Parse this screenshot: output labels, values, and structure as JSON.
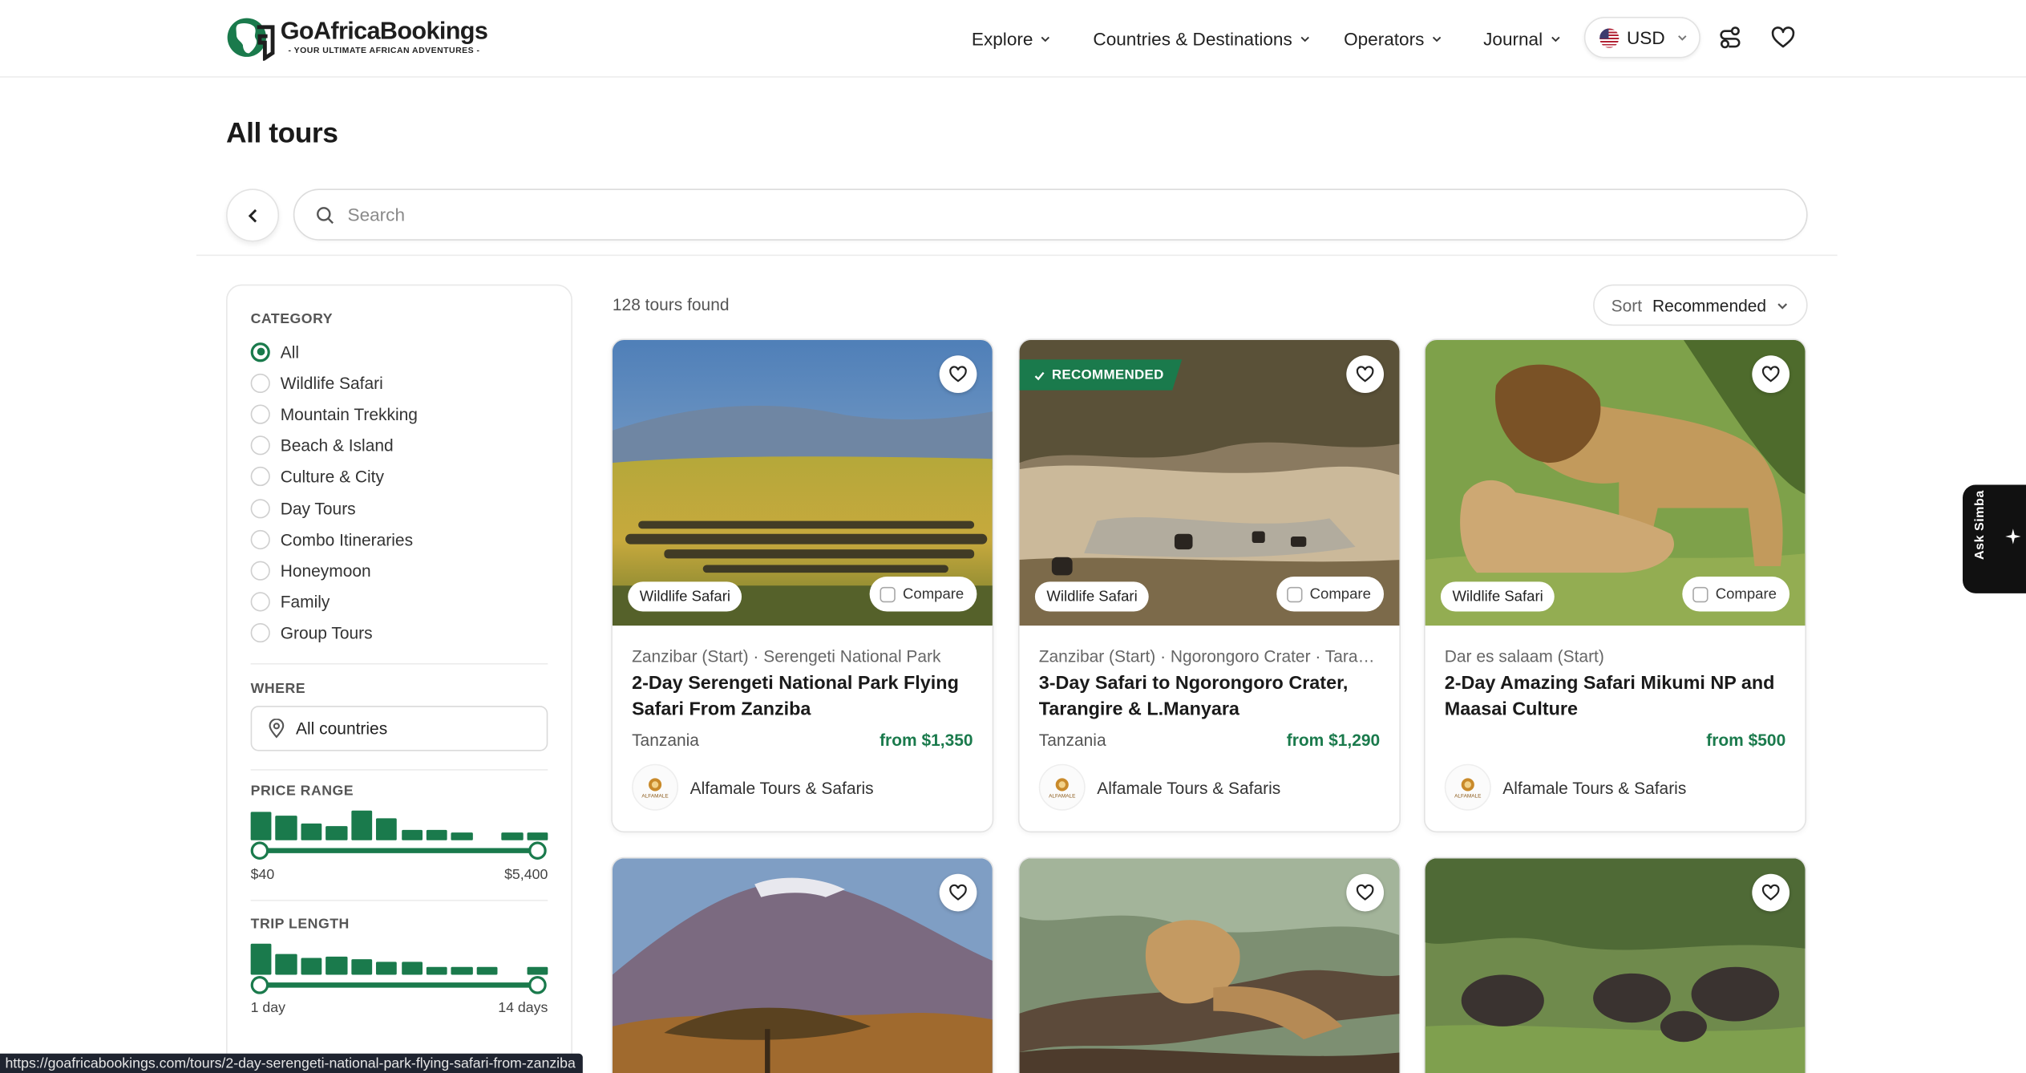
{
  "brand": {
    "name_part1": "GoAfrica",
    "name_part2": "Bookings",
    "tagline": "- YOUR ULTIMATE AFRICAN ADVENTURES -"
  },
  "nav": {
    "items": [
      {
        "label": "Explore"
      },
      {
        "label": "Countries & Destinations"
      },
      {
        "label": "Operators"
      },
      {
        "label": "Journal"
      }
    ],
    "currency": "USD"
  },
  "page": {
    "title": "All tours"
  },
  "search": {
    "placeholder": "Search",
    "value": ""
  },
  "filters": {
    "category_heading": "CATEGORY",
    "categories": [
      {
        "label": "All",
        "selected": true
      },
      {
        "label": "Wildlife Safari",
        "selected": false
      },
      {
        "label": "Mountain Trekking",
        "selected": false
      },
      {
        "label": "Beach & Island",
        "selected": false
      },
      {
        "label": "Culture & City",
        "selected": false
      },
      {
        "label": "Day Tours",
        "selected": false
      },
      {
        "label": "Combo Itineraries",
        "selected": false
      },
      {
        "label": "Honeymoon",
        "selected": false
      },
      {
        "label": "Family",
        "selected": false
      },
      {
        "label": "Group Tours",
        "selected": false
      }
    ],
    "where_heading": "WHERE",
    "where_value": "All countries",
    "price_heading": "PRICE RANGE",
    "price_min": "$40",
    "price_max": "$5,400",
    "price_histogram": [
      0.9,
      0.8,
      0.55,
      0.45,
      0.95,
      0.7,
      0.35,
      0.35,
      0.25,
      0.0,
      0.25,
      0.25
    ],
    "trip_heading": "TRIP LENGTH",
    "trip_min": "1 day",
    "trip_max": "14 days",
    "trip_histogram": [
      1.0,
      0.65,
      0.55,
      0.6,
      0.5,
      0.4,
      0.4,
      0.25,
      0.25,
      0.25,
      0.0,
      0.25
    ]
  },
  "results": {
    "count_text": "128 tours found",
    "sort_label": "Sort",
    "sort_value": "Recommended",
    "recommended_badge": "RECOMMENDED",
    "compare_label": "Compare",
    "cards": [
      {
        "category": "Wildlife Safari",
        "location": "Zanzibar (Start) · Serengeti National Park",
        "title": "2-Day Serengeti National Park Flying Safari From Zanziba",
        "country": "Tanzania",
        "price": "from $1,350",
        "operator": "Alfamale Tours & Safaris",
        "recommended": false
      },
      {
        "category": "Wildlife Safari",
        "location": "Zanzibar (Start) · Ngorongoro Crater · Tarangire",
        "title": "3-Day Safari to Ngorongoro Crater, Tarangire & L.Manyara",
        "country": "Tanzania",
        "price": "from $1,290",
        "operator": "Alfamale Tours & Safaris",
        "recommended": true
      },
      {
        "category": "Wildlife Safari",
        "location": "Dar es salaam (Start)",
        "title": "2-Day Amazing Safari Mikumi NP and Maasai Culture",
        "country": "",
        "price": "from $500",
        "operator": "Alfamale Tours & Safaris",
        "recommended": false
      }
    ],
    "operator_logo_text": "ALFAMALE"
  },
  "assistant": {
    "label": "Ask Simba"
  },
  "status_bar": {
    "url": "https://goafricabookings.com/tours/2-day-serengeti-national-park-flying-safari-from-zanziba"
  },
  "colors": {
    "brand_green": "#1a7a4c",
    "text_dark": "#1a1a1a"
  }
}
